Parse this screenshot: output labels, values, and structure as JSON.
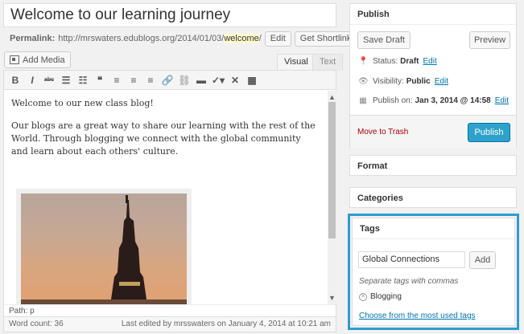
{
  "post": {
    "title": "Welcome to our learning journey",
    "permalink_label": "Permalink:",
    "permalink_base": "http://mrswaters.edublogs.org/2014/01/03/",
    "permalink_slug": "welcome",
    "permalink_trail": "/",
    "edit_button": "Edit",
    "shortlink_button": "Get Shortlink"
  },
  "editor": {
    "add_media": "Add Media",
    "tab_visual": "Visual",
    "tab_text": "Text",
    "toolbar": [
      {
        "icon": "bold-icon",
        "glyph": "B"
      },
      {
        "icon": "italic-icon",
        "glyph": "I"
      },
      {
        "icon": "strikethrough-icon",
        "glyph": "abc"
      },
      {
        "icon": "bullet-list-icon",
        "glyph": "☰"
      },
      {
        "icon": "numbered-list-icon",
        "glyph": "☷"
      },
      {
        "icon": "blockquote-icon",
        "glyph": "❝"
      },
      {
        "icon": "align-left-icon",
        "glyph": "≡"
      },
      {
        "icon": "align-center-icon",
        "glyph": "≡"
      },
      {
        "icon": "align-right-icon",
        "glyph": "≡"
      },
      {
        "icon": "link-icon",
        "glyph": "🔗"
      },
      {
        "icon": "unlink-icon",
        "glyph": "⛓"
      },
      {
        "icon": "more-tag-icon",
        "glyph": "▬"
      },
      {
        "icon": "spellcheck-icon",
        "glyph": "✓▾"
      },
      {
        "icon": "fullscreen-icon",
        "glyph": "✕"
      },
      {
        "icon": "kitchen-sink-icon",
        "glyph": "▦"
      }
    ],
    "paragraph_1": "Welcome to our new class blog!",
    "paragraph_2": "Our blogs are a great way to share our learning with the rest of the World. Through blogging we connect with the global community and learn about each others' culture.",
    "path": "Path: p",
    "word_count": "Word count: 36",
    "last_edited": "Last edited by mrsswaters on January 4, 2014 at 10:21 am"
  },
  "publish": {
    "title": "Publish",
    "save_draft": "Save Draft",
    "preview": "Preview",
    "status_label": "Status:",
    "status_value": "Draft",
    "visibility_label": "Visibility:",
    "visibility_value": "Public",
    "published_label": "Publish on:",
    "published_value": "Jan 3, 2014 @ 14:58",
    "edit_link": "Edit",
    "trash": "Move to Trash",
    "publish_button": "Publish"
  },
  "format": {
    "title": "Format"
  },
  "categories": {
    "title": "Categories"
  },
  "tags": {
    "title": "Tags",
    "input_value": "Global Connections",
    "add_button": "Add",
    "hint": "Separate tags with commas",
    "items": [
      "Blogging"
    ],
    "choose_link": "Choose from the most used tags"
  },
  "colors": {
    "accent": "#2ea2cc",
    "highlight_border": "#2f9bd1",
    "link": "#0073aa",
    "trash": "#aa0000"
  }
}
